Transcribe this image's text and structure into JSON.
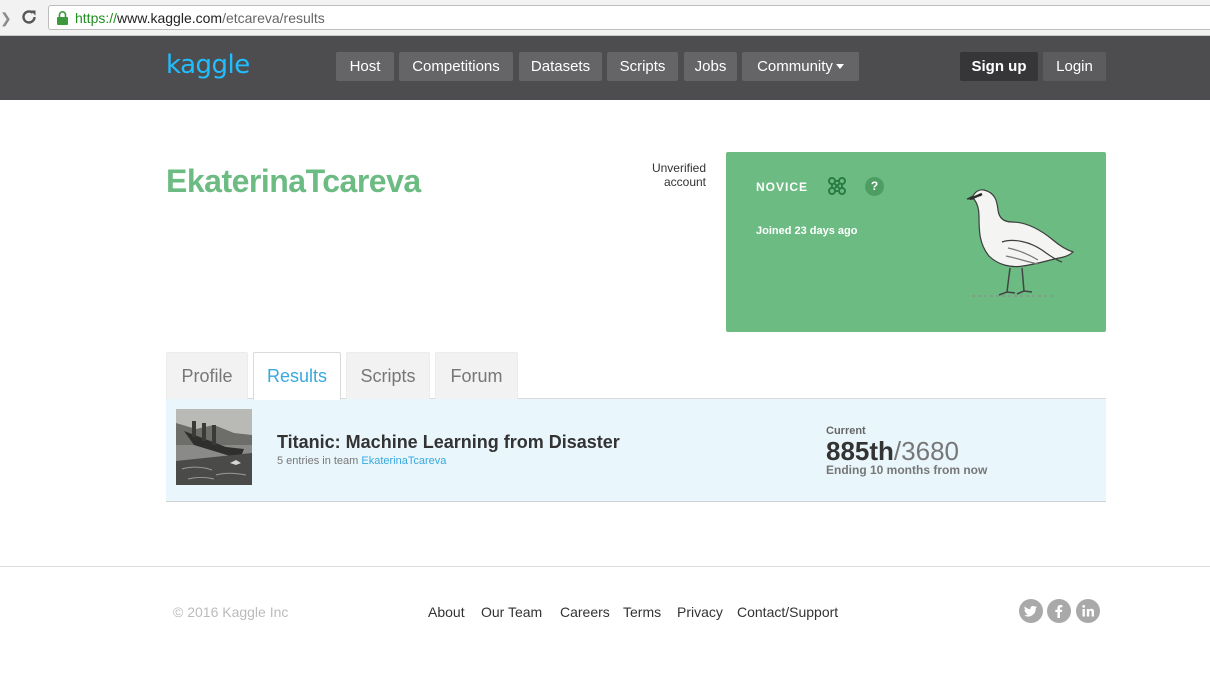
{
  "browser": {
    "url_scheme": "https://",
    "url_host": "www.kaggle.com",
    "url_path": "/etcareva/results"
  },
  "header": {
    "logo": "kaggle",
    "nav": [
      "Host",
      "Competitions",
      "Datasets",
      "Scripts",
      "Jobs",
      "Community"
    ],
    "signup_label": "Sign up",
    "login_label": "Login"
  },
  "profile": {
    "username": "EkaterinaTcareva",
    "account_status_line1": "Unverified",
    "account_status_line2": "account",
    "tier": "NOVICE",
    "help_label": "?",
    "joined": "Joined 23 days ago"
  },
  "tabs": [
    "Profile",
    "Results",
    "Scripts",
    "Forum"
  ],
  "results": [
    {
      "title": "Titanic: Machine Learning from Disaster",
      "entries_prefix": "5 entries in team",
      "team": "EkaterinaTcareva",
      "current_label": "Current",
      "rank": "885th",
      "total": "/3680",
      "ending": "Ending 10 months from now"
    }
  ],
  "footer": {
    "copyright": "© 2016 Kaggle Inc",
    "links": [
      "About",
      "Our Team",
      "Careers",
      "Terms",
      "Privacy",
      "Contact/Support"
    ]
  },
  "colors": {
    "brand": "#20beff",
    "novice_green": "#6bbb82",
    "header_bg": "#4d4d4f",
    "link_blue": "#38a9df"
  }
}
